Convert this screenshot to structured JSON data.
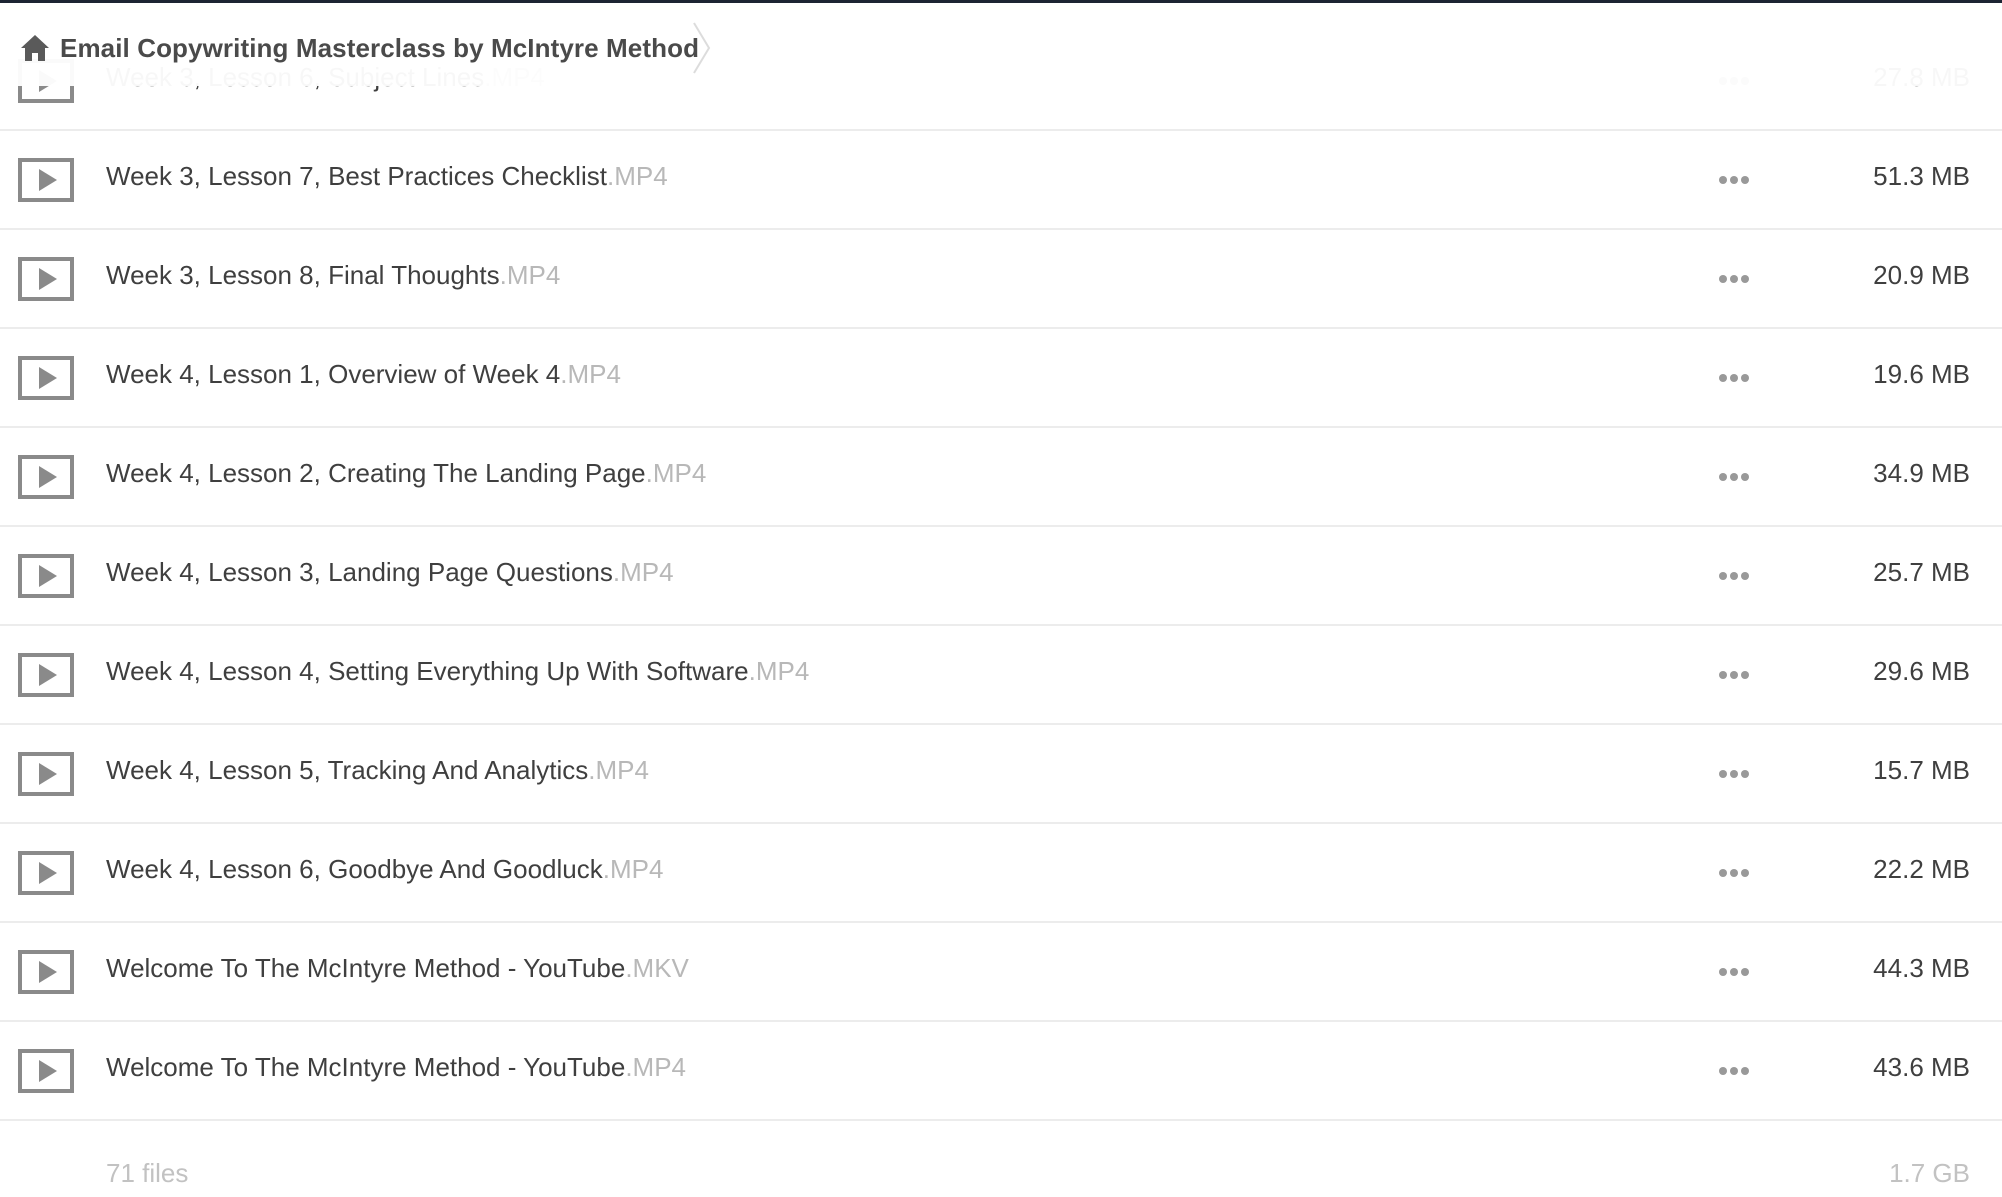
{
  "breadcrumb": {
    "home_icon": "home-icon",
    "folder_title": "Email Copywriting Masterclass by McIntyre Method"
  },
  "files": [
    {
      "name": "Week 3, Lesson 6, Subject Lines",
      "ext": ".MP4",
      "size": "27.8 MB",
      "icon": "play-icon"
    },
    {
      "name": "Week 3, Lesson 7, Best Practices Checklist",
      "ext": ".MP4",
      "size": "51.3 MB",
      "icon": "play-icon"
    },
    {
      "name": "Week 3, Lesson 8, Final Thoughts",
      "ext": ".MP4",
      "size": "20.9 MB",
      "icon": "play-icon"
    },
    {
      "name": "Week 4, Lesson 1, Overview of Week 4",
      "ext": ".MP4",
      "size": "19.6 MB",
      "icon": "play-icon"
    },
    {
      "name": "Week 4, Lesson 2, Creating The Landing Page",
      "ext": ".MP4",
      "size": "34.9 MB",
      "icon": "play-icon"
    },
    {
      "name": "Week 4, Lesson 3, Landing Page Questions",
      "ext": ".MP4",
      "size": "25.7 MB",
      "icon": "play-icon"
    },
    {
      "name": "Week 4, Lesson 4, Setting Everything Up With Software",
      "ext": ".MP4",
      "size": "29.6 MB",
      "icon": "play-icon"
    },
    {
      "name": "Week 4, Lesson 5, Tracking And Analytics",
      "ext": ".MP4",
      "size": "15.7 MB",
      "icon": "play-icon"
    },
    {
      "name": "Week 4, Lesson 6, Goodbye And Goodluck",
      "ext": ".MP4",
      "size": "22.2 MB",
      "icon": "play-icon"
    },
    {
      "name": "Welcome To The McIntyre Method - YouTube",
      "ext": ".MKV",
      "size": "44.3 MB",
      "icon": "play-icon"
    },
    {
      "name": "Welcome To The McIntyre Method - YouTube",
      "ext": ".MP4",
      "size": "43.6 MB",
      "icon": "play-icon"
    }
  ],
  "footer": {
    "file_count": "71 files",
    "total_size": "1.7 GB"
  },
  "colors": {
    "top_border": "#1c2433",
    "icon_gray": "#8a8a8a",
    "extension_gray": "#b8b8b8",
    "row_divider": "#ececec"
  }
}
